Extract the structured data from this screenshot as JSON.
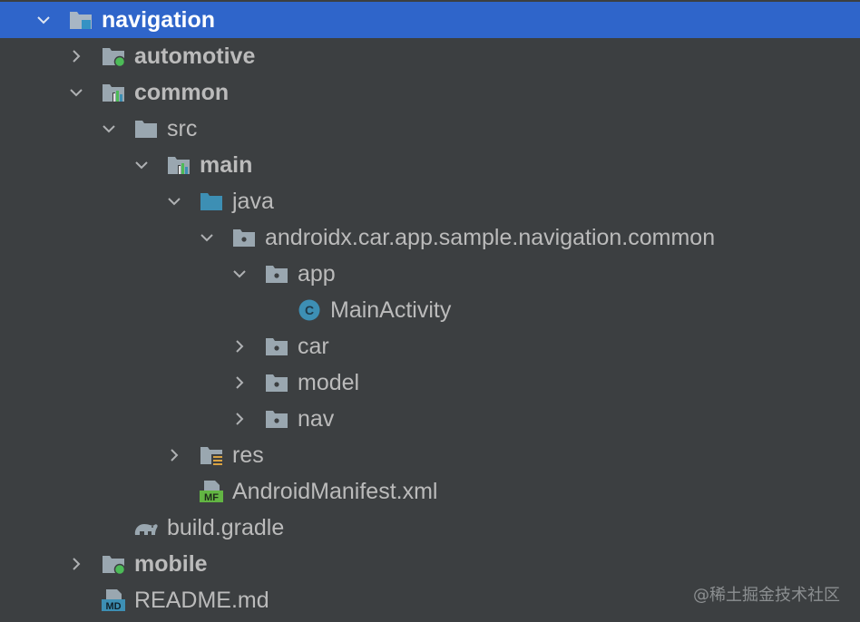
{
  "tree": {
    "items": [
      {
        "label": "navigation",
        "expanded": true,
        "selected": true,
        "icon": "module-folder-icon"
      },
      {
        "label": "automotive",
        "expanded": false,
        "icon": "app-module-folder-icon"
      },
      {
        "label": "common",
        "expanded": true,
        "icon": "library-module-folder-icon"
      },
      {
        "label": "src",
        "expanded": true,
        "icon": "folder-icon"
      },
      {
        "label": "main",
        "expanded": true,
        "icon": "source-set-folder-icon"
      },
      {
        "label": "java",
        "expanded": true,
        "icon": "source-root-folder-icon"
      },
      {
        "label": "androidx.car.app.sample.navigation.common",
        "expanded": true,
        "icon": "package-icon"
      },
      {
        "label": "app",
        "expanded": true,
        "icon": "package-icon"
      },
      {
        "label": "MainActivity",
        "icon": "java-class-icon"
      },
      {
        "label": "car",
        "expanded": false,
        "icon": "package-icon"
      },
      {
        "label": "model",
        "expanded": false,
        "icon": "package-icon"
      },
      {
        "label": "nav",
        "expanded": false,
        "icon": "package-icon"
      },
      {
        "label": "res",
        "expanded": false,
        "icon": "resources-folder-icon"
      },
      {
        "label": "AndroidManifest.xml",
        "icon": "manifest-file-icon"
      },
      {
        "label": "build.gradle",
        "icon": "gradle-file-icon"
      },
      {
        "label": "mobile",
        "expanded": false,
        "icon": "app-module-folder-icon"
      },
      {
        "label": "README.md",
        "icon": "markdown-file-icon"
      }
    ]
  },
  "icons": {
    "class_letter": "C",
    "manifest_badge": "MF",
    "markdown_badge": "MD"
  },
  "watermark": "@稀土掘金技术社区",
  "colors": {
    "background": "#3c3f41",
    "selection": "#2f65ca",
    "text": "#bbbbbb",
    "folder": "#9aa7b0",
    "source_folder": "#3d8fb4",
    "module_dot": "#4cbb57",
    "class_icon": "#3d8fb4"
  }
}
